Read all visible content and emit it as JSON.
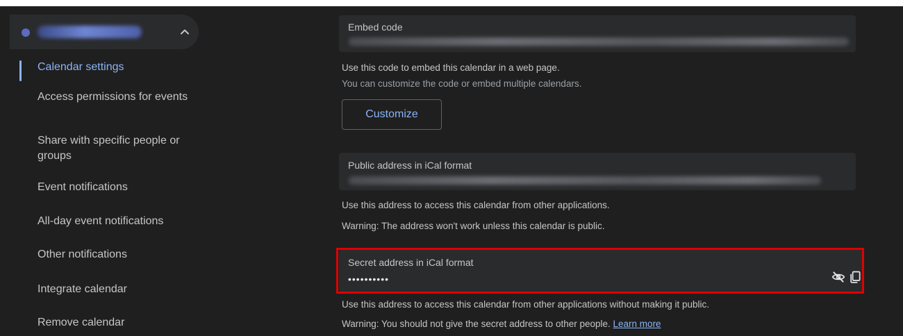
{
  "sidebar": {
    "items": [
      {
        "label": "Calendar settings",
        "active": true
      },
      {
        "label": "Access permissions for events"
      },
      {
        "label": "Share with specific people or groups"
      },
      {
        "label": "Event notifications"
      },
      {
        "label": "All-day event notifications"
      },
      {
        "label": "Other notifications"
      },
      {
        "label": "Integrate calendar"
      },
      {
        "label": "Remove calendar"
      }
    ]
  },
  "embed": {
    "label": "Embed code",
    "desc1": "Use this code to embed this calendar in a web page.",
    "desc2": "You can customize the code or embed multiple calendars.",
    "customize_label": "Customize"
  },
  "public_ical": {
    "label": "Public address in iCal format",
    "desc1": "Use this address to access this calendar from other applications.",
    "desc2": "Warning: The address won't work unless this calendar is public."
  },
  "secret_ical": {
    "label": "Secret address in iCal format",
    "value": "••••••••••",
    "desc1": "Use this address to access this calendar from other applications without making it public.",
    "desc2": "Warning: You should not give the secret address to other people.",
    "learn_more": "Learn more"
  },
  "colors": {
    "background": "#1f1f1f",
    "field": "#2a2b2d",
    "accent": "#8ab4f8",
    "highlight": "#e00000"
  }
}
